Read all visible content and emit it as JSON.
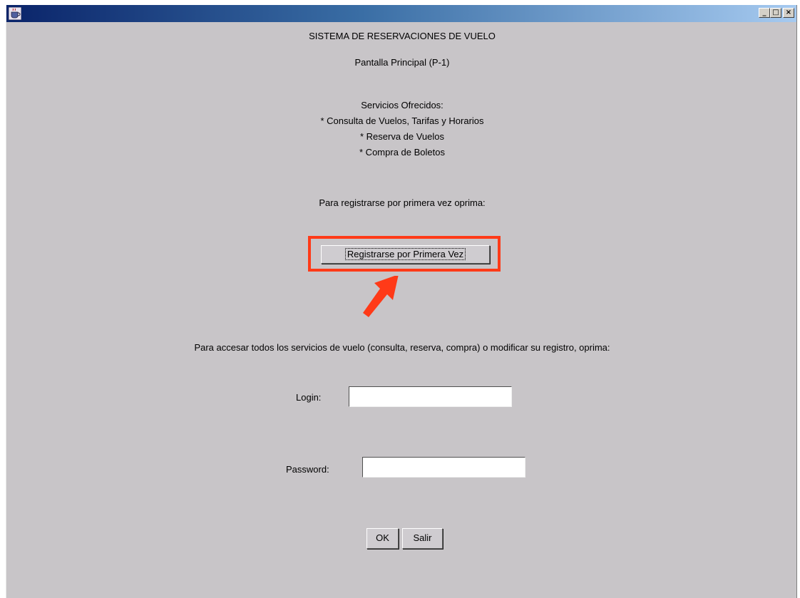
{
  "window": {
    "title": "",
    "controls": {
      "minimize": "_",
      "maximize": "□",
      "close": "×"
    }
  },
  "header": {
    "system_title": "SISTEMA DE RESERVACIONES DE VUELO",
    "screen_title": "Pantalla Principal (P-1)"
  },
  "services": {
    "heading": "Servicios Ofrecidos:",
    "items": [
      "* Consulta de Vuelos, Tarifas y Horarios",
      "* Reserva de Vuelos",
      "* Compra de Boletos"
    ]
  },
  "register": {
    "prompt": "Para registrarse por primera vez oprima:",
    "button_label": "Registrarse por Primera Vez"
  },
  "access": {
    "prompt": "Para accesar todos los servicios de vuelo (consulta, reserva, compra) o modificar su registro, oprima:"
  },
  "login": {
    "label": "Login:",
    "value": "",
    "placeholder": ""
  },
  "password": {
    "label": "Password:",
    "value": "",
    "placeholder": ""
  },
  "actions": {
    "ok_label": "OK",
    "exit_label": "Salir"
  },
  "colors": {
    "background": "#c8c5c8",
    "highlight": "#ff3a18",
    "titlebar_start": "#0a246a",
    "titlebar_end": "#a6caf0"
  }
}
